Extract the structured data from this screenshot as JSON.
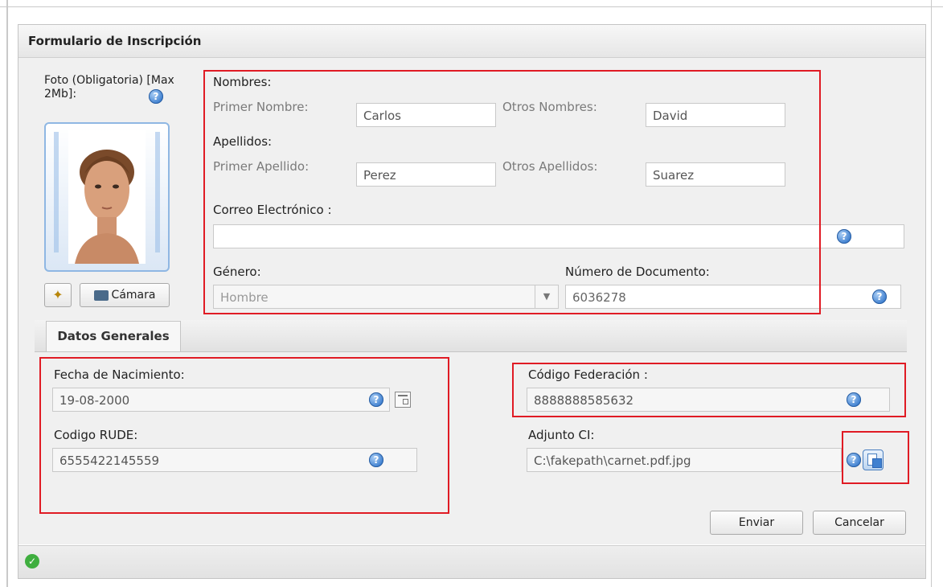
{
  "window": {
    "title": "Formulario de Inscripción"
  },
  "photo": {
    "label": "Foto (Obligatoria) [Max 2Mb]:",
    "help_glyph": "?"
  },
  "photo_buttons": {
    "camera_label": "Cámara",
    "wand_icon": "magic-wand-icon",
    "camera_icon": "camera-icon"
  },
  "nombres": {
    "heading": "Nombres:",
    "primer_label": "Primer Nombre:",
    "primer_value": "Carlos",
    "otros_label": "Otros Nombres:",
    "otros_value": "David"
  },
  "apellidos": {
    "heading": "Apellidos:",
    "primer_label": "Primer Apellido:",
    "primer_value": "Perez",
    "otros_label": "Otros Apellidos:",
    "otros_value": "Suarez"
  },
  "correo": {
    "label": "Correo Electrónico :",
    "value": ""
  },
  "genero": {
    "label": "Género:",
    "selected": "Hombre"
  },
  "documento": {
    "label": "Número de Documento:",
    "value": "6036278"
  },
  "tabs": [
    {
      "label": "Datos Generales"
    }
  ],
  "fecha": {
    "label": "Fecha de Nacimiento:",
    "value": "19-08-2000"
  },
  "rude": {
    "label": "Codigo RUDE:",
    "value": "6555422145559"
  },
  "federacion": {
    "label": "Código Federación :",
    "value": "8888888585632"
  },
  "adjunto": {
    "label": "Adjunto CI:",
    "value": "C:\\fakepath\\carnet.pdf.jpg"
  },
  "actions": {
    "send_label": "Enviar",
    "cancel_label": "Cancelar"
  },
  "colors": {
    "highlight": "#e01b24",
    "help_icon": "#3f80d0",
    "status_ok": "#3fae3f"
  }
}
